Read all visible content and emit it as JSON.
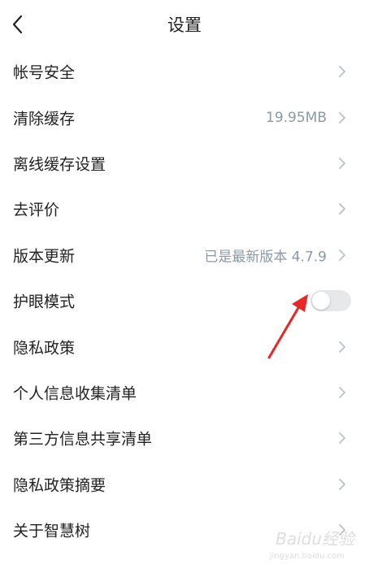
{
  "header": {
    "title": "设置",
    "back_icon": "chevron-left-icon"
  },
  "settings": [
    {
      "label": "帐号安全",
      "value": "",
      "control": "chevron"
    },
    {
      "label": "清除缓存",
      "value": "19.95MB",
      "control": "chevron"
    },
    {
      "label": "离线缓存设置",
      "value": "",
      "control": "chevron"
    },
    {
      "label": "去评价",
      "value": "",
      "control": "chevron"
    },
    {
      "label": "版本更新",
      "value": "已是最新版本  4.7.9",
      "control": "chevron"
    },
    {
      "label": "护眼模式",
      "value": "",
      "control": "toggle",
      "toggle_state": "off"
    },
    {
      "label": "隐私政策",
      "value": "",
      "control": "chevron"
    },
    {
      "label": "个人信息收集清单",
      "value": "",
      "control": "chevron"
    },
    {
      "label": "第三方信息共享清单",
      "value": "",
      "control": "chevron"
    },
    {
      "label": "隐私政策摘要",
      "value": "",
      "control": "chevron"
    },
    {
      "label": "关于智慧树",
      "value": "",
      "control": "chevron"
    }
  ],
  "watermark": {
    "text": "Baidu经验",
    "sub": "jingyan.baidu.com"
  },
  "colors": {
    "text": "#222222",
    "value_text": "#8a9aa4",
    "chevron": "#b9c1c6",
    "toggle_track": "#e6e8ea",
    "annotation_arrow": "#e8272a"
  }
}
